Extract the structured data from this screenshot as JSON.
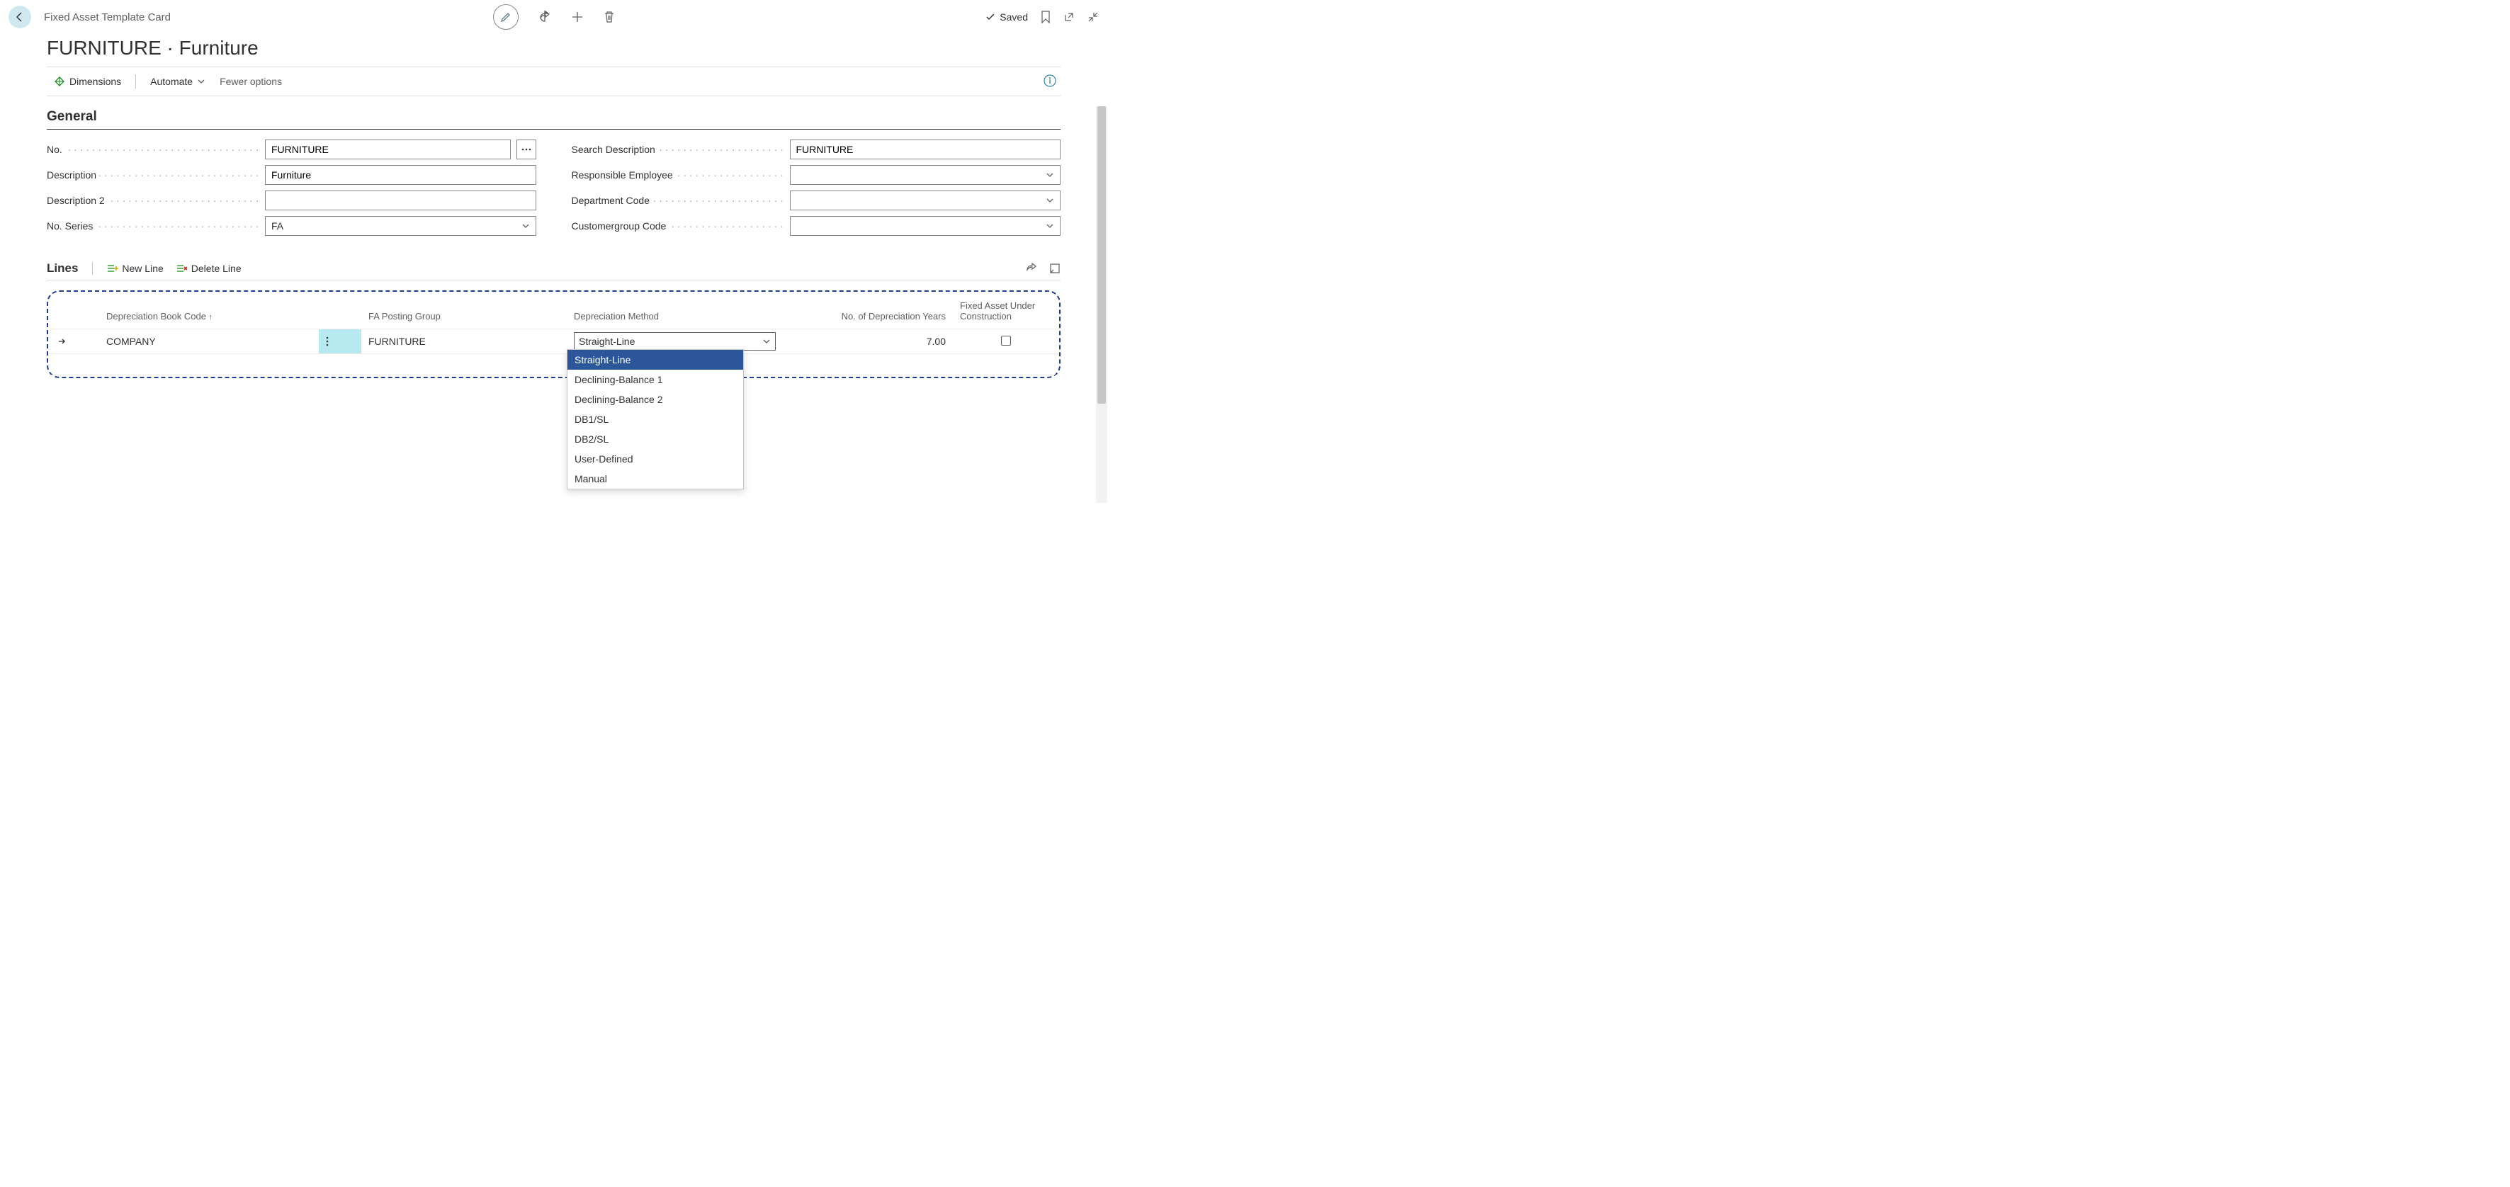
{
  "breadcrumb": "Fixed Asset Template Card",
  "page_title": "FURNITURE · Furniture",
  "saved_label": "Saved",
  "actionbar": {
    "dimensions": "Dimensions",
    "automate": "Automate",
    "fewer_options": "Fewer options"
  },
  "general": {
    "section_title": "General",
    "labels": {
      "no": "No.",
      "description": "Description",
      "description2": "Description 2",
      "no_series": "No. Series",
      "search_description": "Search Description",
      "responsible_employee": "Responsible Employee",
      "department_code": "Department Code",
      "customergroup_code": "Customergroup Code"
    },
    "values": {
      "no": "FURNITURE",
      "description": "Furniture",
      "description2": "",
      "no_series": "FA",
      "search_description": "FURNITURE",
      "responsible_employee": "",
      "department_code": "",
      "customergroup_code": ""
    }
  },
  "lines": {
    "title": "Lines",
    "new_line": "New Line",
    "delete_line": "Delete Line",
    "columns": {
      "dep_book": "Depreciation Book Code",
      "fa_posting_group": "FA Posting Group",
      "dep_method": "Depreciation Method",
      "years": "No. of Depreciation Years",
      "fauc": "Fixed Asset Under Construction"
    },
    "row": {
      "dep_book": "COMPANY",
      "fa_posting_group": "FURNITURE",
      "dep_method": "Straight-Line",
      "years": "7.00"
    },
    "dep_method_options": [
      "Straight-Line",
      "Declining-Balance 1",
      "Declining-Balance 2",
      "DB1/SL",
      "DB2/SL",
      "User-Defined",
      "Manual"
    ]
  }
}
